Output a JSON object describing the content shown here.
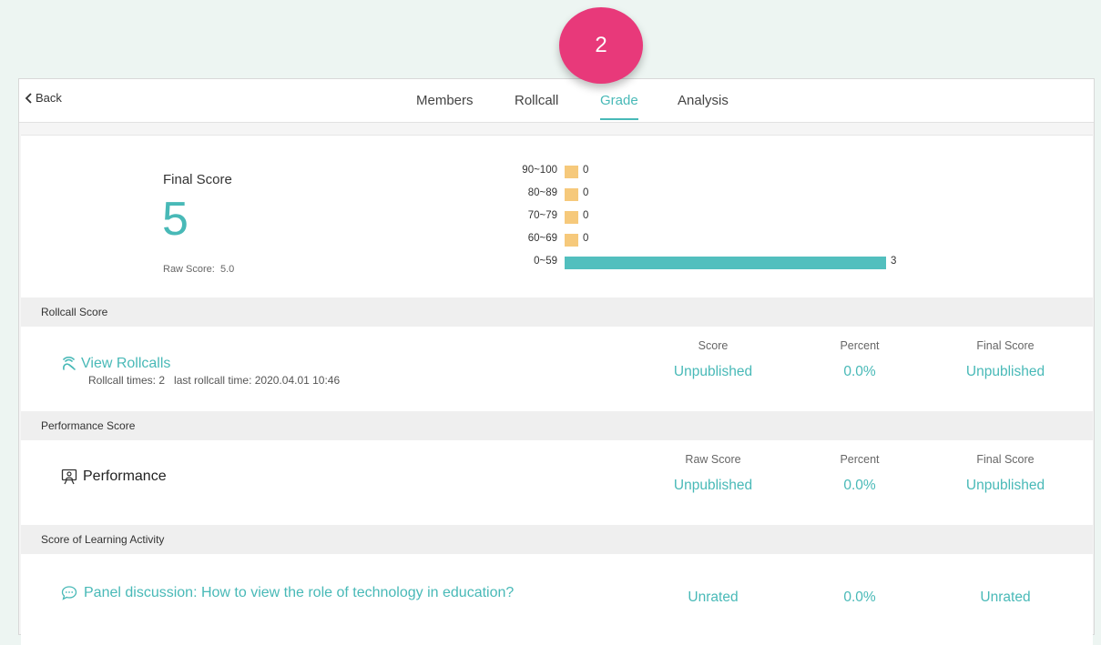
{
  "step_badge": "2",
  "nav": {
    "back_label": "Back",
    "tabs": [
      "Members",
      "Rollcall",
      "Grade",
      "Analysis"
    ],
    "active_tab": "Grade"
  },
  "summary": {
    "final_score_label": "Final Score",
    "final_score_value": "5",
    "raw_score_label": "Raw Score:",
    "raw_score_value": "5.0"
  },
  "chart_data": {
    "type": "bar",
    "orientation": "horizontal",
    "categories": [
      "90~100",
      "80~89",
      "70~79",
      "60~69",
      "0~59"
    ],
    "values": [
      0,
      0,
      0,
      0,
      3
    ],
    "colors": [
      "#f6c97b",
      "#f6c97b",
      "#f6c97b",
      "#f6c97b",
      "#52bfbe"
    ],
    "xlim": [
      0,
      3
    ]
  },
  "rollcall": {
    "section_title": "Rollcall Score",
    "link_label": "View Rollcalls",
    "times_text": "Rollcall times: 2",
    "last_time_text": "last rollcall time: 2020.04.01 10:46",
    "columns": [
      "Score",
      "Percent",
      "Final Score"
    ],
    "values": [
      "Unpublished",
      "0.0%",
      "Unpublished"
    ]
  },
  "performance": {
    "section_title": "Performance Score",
    "label": "Performance",
    "columns": [
      "Raw Score",
      "Percent",
      "Final Score"
    ],
    "values": [
      "Unpublished",
      "0.0%",
      "Unpublished"
    ]
  },
  "learning": {
    "section_title": "Score of Learning Activity",
    "activity_label": "Panel discussion: How to view the role of technology in education?",
    "values": [
      "Unrated",
      "0.0%",
      "Unrated"
    ]
  },
  "colors": {
    "accent": "#48b9b7",
    "badge": "#e8397a",
    "small_bar": "#f6c97b",
    "large_bar": "#52bfbe"
  },
  "icons": {
    "back": "chevron-left-icon",
    "rollcall": "rollcall-hand-icon",
    "performance": "presenter-icon",
    "discussion": "chat-bubble-icon"
  }
}
